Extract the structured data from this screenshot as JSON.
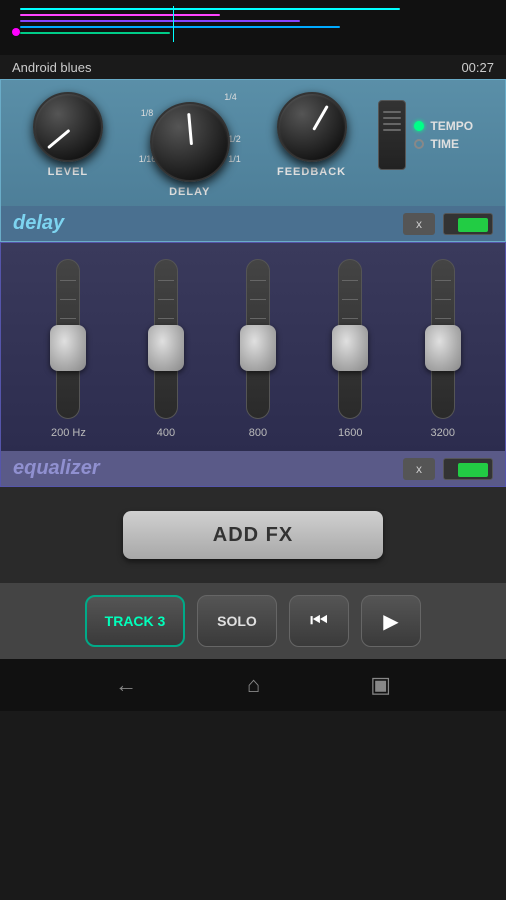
{
  "app": {
    "song_title": "Android blues",
    "time_display": "00:27"
  },
  "delay_plugin": {
    "name": "delay",
    "level_label": "LEVEL",
    "delay_label": "DELAY",
    "feedback_label": "FEEDBACK",
    "tempo_label": "TEMPO",
    "time_label": "TIME",
    "x_button": "x",
    "ticks": [
      "1/8",
      "1/4",
      "1/16",
      "1/2",
      "1/1"
    ]
  },
  "equalizer_plugin": {
    "name": "equalizer",
    "x_button": "x",
    "bands": [
      {
        "freq": "200 Hz"
      },
      {
        "freq": "400"
      },
      {
        "freq": "800"
      },
      {
        "freq": "1600"
      },
      {
        "freq": "3200"
      }
    ]
  },
  "add_fx": {
    "label": "ADD FX"
  },
  "transport": {
    "track_label": "TRACK 3",
    "solo_label": "SOLO"
  },
  "android_nav": {
    "back_icon": "←",
    "home_icon": "⌂",
    "recents_icon": "▣"
  }
}
